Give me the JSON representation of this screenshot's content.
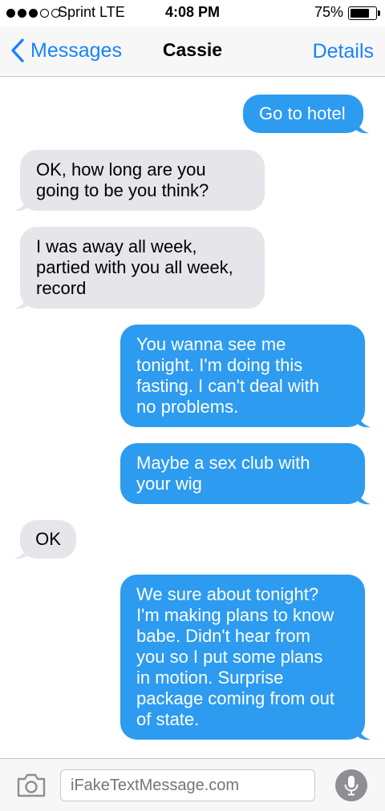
{
  "status_bar": {
    "carrier": "Sprint  LTE",
    "time": "4:08 PM",
    "battery": "75%",
    "battery_level": 0.75,
    "signal_bars": 3,
    "signal_total": 5
  },
  "nav": {
    "back_label": "Messages",
    "title": "Cassie",
    "details_label": "Details"
  },
  "colors": {
    "sent_bubble": "#2d9bf0",
    "received_bubble": "#e5e5ea",
    "accent": "#1a82fb"
  },
  "messages": [
    {
      "direction": "sent",
      "lines": [
        "Go to hotel"
      ]
    },
    {
      "direction": "received",
      "lines": [
        "OK, how long are you",
        "going to be you think?"
      ]
    },
    {
      "direction": "received",
      "lines": [
        "I was away all week,",
        "partied with you all week,",
        "record"
      ]
    },
    {
      "direction": "sent",
      "lines": [
        "You wanna see me",
        "tonight. I'm doing this",
        "fasting. I can't deal with",
        "no problems."
      ]
    },
    {
      "direction": "sent",
      "lines": [
        "Maybe a sex club with",
        "your wig"
      ]
    },
    {
      "direction": "received",
      "lines": [
        "OK"
      ]
    },
    {
      "direction": "sent",
      "lines": [
        "We sure about tonight?",
        "I'm making plans to know",
        "babe. Didn't hear from",
        "you so I put some plans",
        "in motion. Surprise",
        "package coming from out",
        "of state."
      ]
    }
  ],
  "input": {
    "placeholder": "iFakeTextMessage.com",
    "camera_icon": "camera-icon",
    "mic_icon": "microphone-icon"
  }
}
